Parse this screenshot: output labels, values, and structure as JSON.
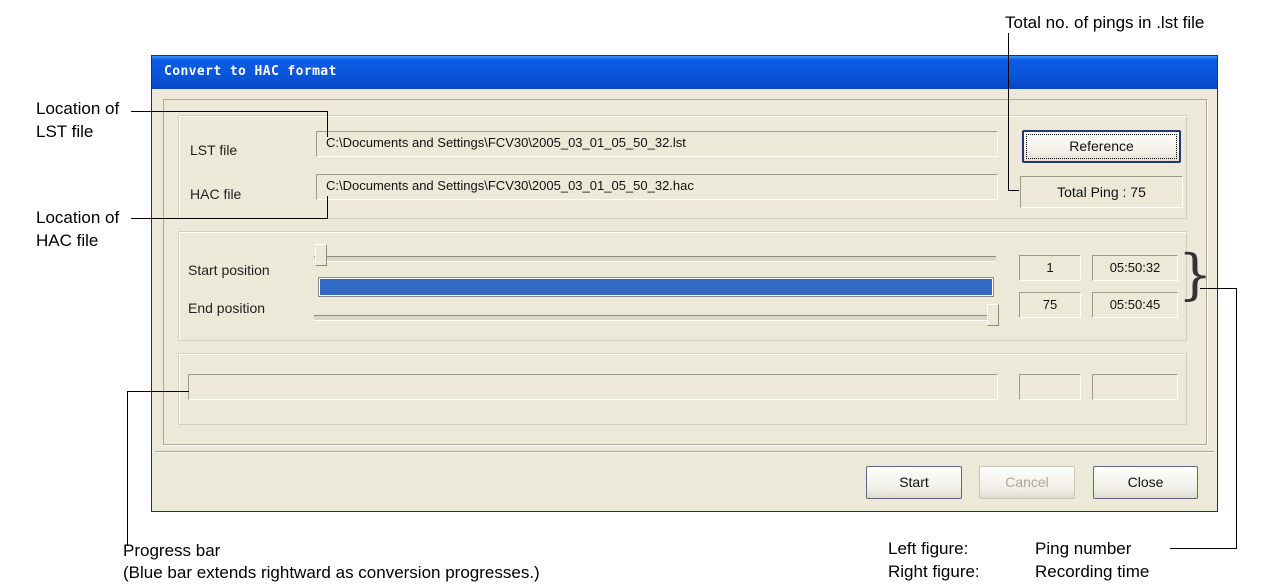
{
  "window": {
    "title": "Convert to HAC format"
  },
  "files": {
    "lst_label": "LST file",
    "lst_path": "C:\\Documents and Settings\\FCV30\\2005_03_01_05_50_32.lst",
    "hac_label": "HAC file",
    "hac_path": "C:\\Documents and Settings\\FCV30\\2005_03_01_05_50_32.hac",
    "reference_button": "Reference",
    "total_ping": "Total Ping : 75"
  },
  "range": {
    "start_label": "Start position",
    "end_label": "End position",
    "start_ping": "1",
    "start_time": "05:50:32",
    "end_ping": "75",
    "end_time": "05:50:45"
  },
  "progress": {
    "ping": "",
    "time": ""
  },
  "buttons": {
    "start": "Start",
    "cancel": "Cancel",
    "close": "Close"
  },
  "annotations": {
    "lst_location_line1": "Location of",
    "lst_location_line2": "LST file",
    "hac_location_line1": "Location of",
    "hac_location_line2": "HAC file",
    "total_pings": "Total no. of pings in .lst file",
    "progress_bar_line1": "Progress bar",
    "progress_bar_line2": "(Blue bar extends rightward as conversion progresses.)",
    "left_figure_label": "Left figure:",
    "left_figure_value": "Ping number",
    "right_figure_label": "Right figure:",
    "right_figure_value": "Recording time"
  }
}
